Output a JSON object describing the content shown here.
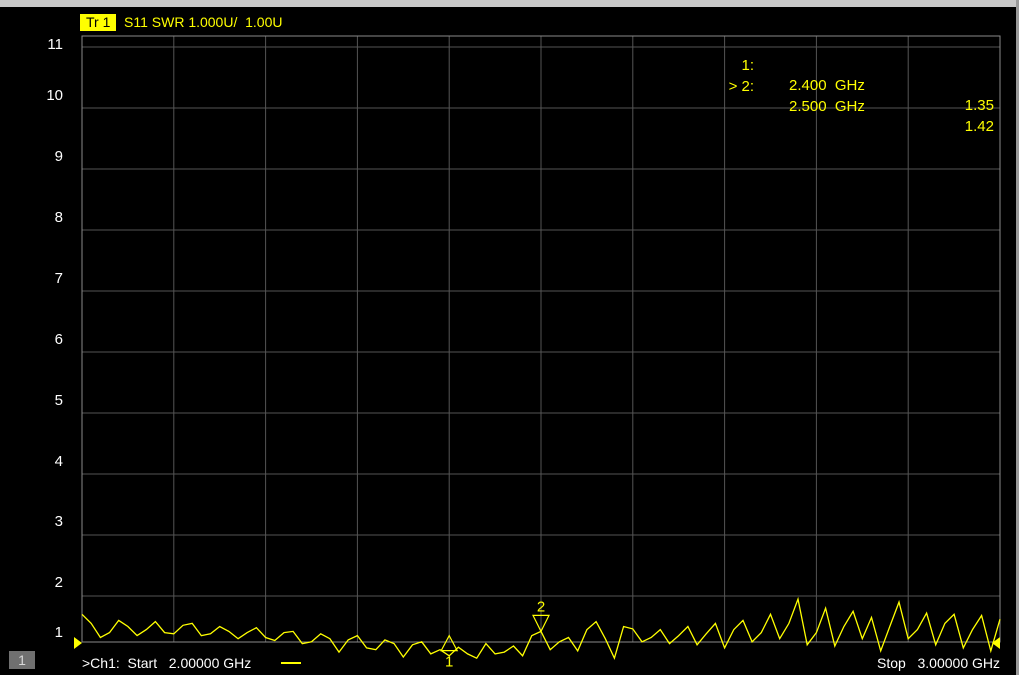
{
  "trace": {
    "badge": "Tr 1",
    "title": "S11 SWR 1.000U/  1.00U"
  },
  "markers_readout": [
    {
      "id": "1:",
      "freq": "2.400  GHz",
      "value": "1.35"
    },
    {
      "id": "> 2:",
      "freq": "2.500  GHz",
      "value": "1.42"
    }
  ],
  "channel": {
    "badge": "1",
    "start": ">Ch1:  Start   2.00000 GHz",
    "stop": "Stop   3.00000 GHz"
  },
  "colors": {
    "trace": "#ffff00",
    "grid": "#555555",
    "background": "#000000",
    "text": "#ffffff"
  },
  "chart_data": {
    "type": "line",
    "title": "S11 SWR 1.000U/  1.00U",
    "xlabel": "",
    "ylabel": "",
    "xlim": [
      2.0,
      3.0
    ],
    "ylim": [
      1,
      11
    ],
    "grid": true,
    "yticks": [
      "11",
      "10",
      "9",
      "8",
      "7",
      "6",
      "5",
      "4",
      "3",
      "2",
      "1"
    ],
    "markers": [
      {
        "label": "1",
        "x": 2.4,
        "y": 1.35
      },
      {
        "label": "2",
        "x": 2.5,
        "y": 1.42
      }
    ],
    "series": [
      {
        "x": [
          2.0,
          2.01,
          2.02,
          2.03,
          2.04,
          2.05,
          2.06,
          2.07,
          2.08,
          2.09,
          2.1,
          2.11,
          2.12,
          2.13,
          2.14,
          2.15,
          2.16,
          2.17,
          2.18,
          2.19,
          2.2,
          2.21,
          2.22,
          2.23,
          2.24,
          2.25,
          2.26,
          2.27,
          2.28,
          2.29,
          2.3,
          2.31,
          2.32,
          2.33,
          2.34,
          2.35,
          2.36,
          2.37,
          2.38,
          2.39,
          2.4,
          2.41,
          2.42,
          2.43,
          2.44,
          2.45,
          2.46,
          2.47,
          2.48,
          2.49,
          2.5,
          2.51,
          2.52,
          2.53,
          2.54,
          2.55,
          2.56,
          2.57,
          2.58,
          2.59,
          2.6,
          2.61,
          2.62,
          2.63,
          2.64,
          2.65,
          2.66,
          2.67,
          2.68,
          2.69,
          2.7,
          2.71,
          2.72,
          2.73,
          2.74,
          2.75,
          2.76,
          2.77,
          2.78,
          2.79,
          2.8,
          2.81,
          2.82,
          2.83,
          2.84,
          2.85,
          2.86,
          2.87,
          2.88,
          2.89,
          2.9,
          2.91,
          2.92,
          2.93,
          2.94,
          2.95,
          2.96,
          2.97,
          2.98,
          2.99,
          3.0
        ],
        "y": [
          1.7,
          1.55,
          1.32,
          1.4,
          1.6,
          1.5,
          1.35,
          1.45,
          1.58,
          1.4,
          1.38,
          1.52,
          1.55,
          1.35,
          1.38,
          1.5,
          1.42,
          1.3,
          1.4,
          1.48,
          1.32,
          1.27,
          1.4,
          1.42,
          1.22,
          1.25,
          1.38,
          1.3,
          1.08,
          1.28,
          1.35,
          1.15,
          1.12,
          1.28,
          1.22,
          1.0,
          1.2,
          1.25,
          1.05,
          1.12,
          1.02,
          1.16,
          1.05,
          0.98,
          1.22,
          1.05,
          1.08,
          1.18,
          1.02,
          1.35,
          1.42,
          1.12,
          1.25,
          1.32,
          1.1,
          1.45,
          1.58,
          1.3,
          0.98,
          1.5,
          1.46,
          1.25,
          1.32,
          1.45,
          1.22,
          1.35,
          1.5,
          1.2,
          1.38,
          1.55,
          1.15,
          1.45,
          1.6,
          1.25,
          1.4,
          1.7,
          1.3,
          1.55,
          1.95,
          1.2,
          1.4,
          1.8,
          1.18,
          1.5,
          1.75,
          1.3,
          1.65,
          1.1,
          1.5,
          1.9,
          1.3,
          1.45,
          1.72,
          1.2,
          1.55,
          1.7,
          1.15,
          1.45,
          1.68,
          1.1,
          1.62
        ]
      }
    ]
  }
}
